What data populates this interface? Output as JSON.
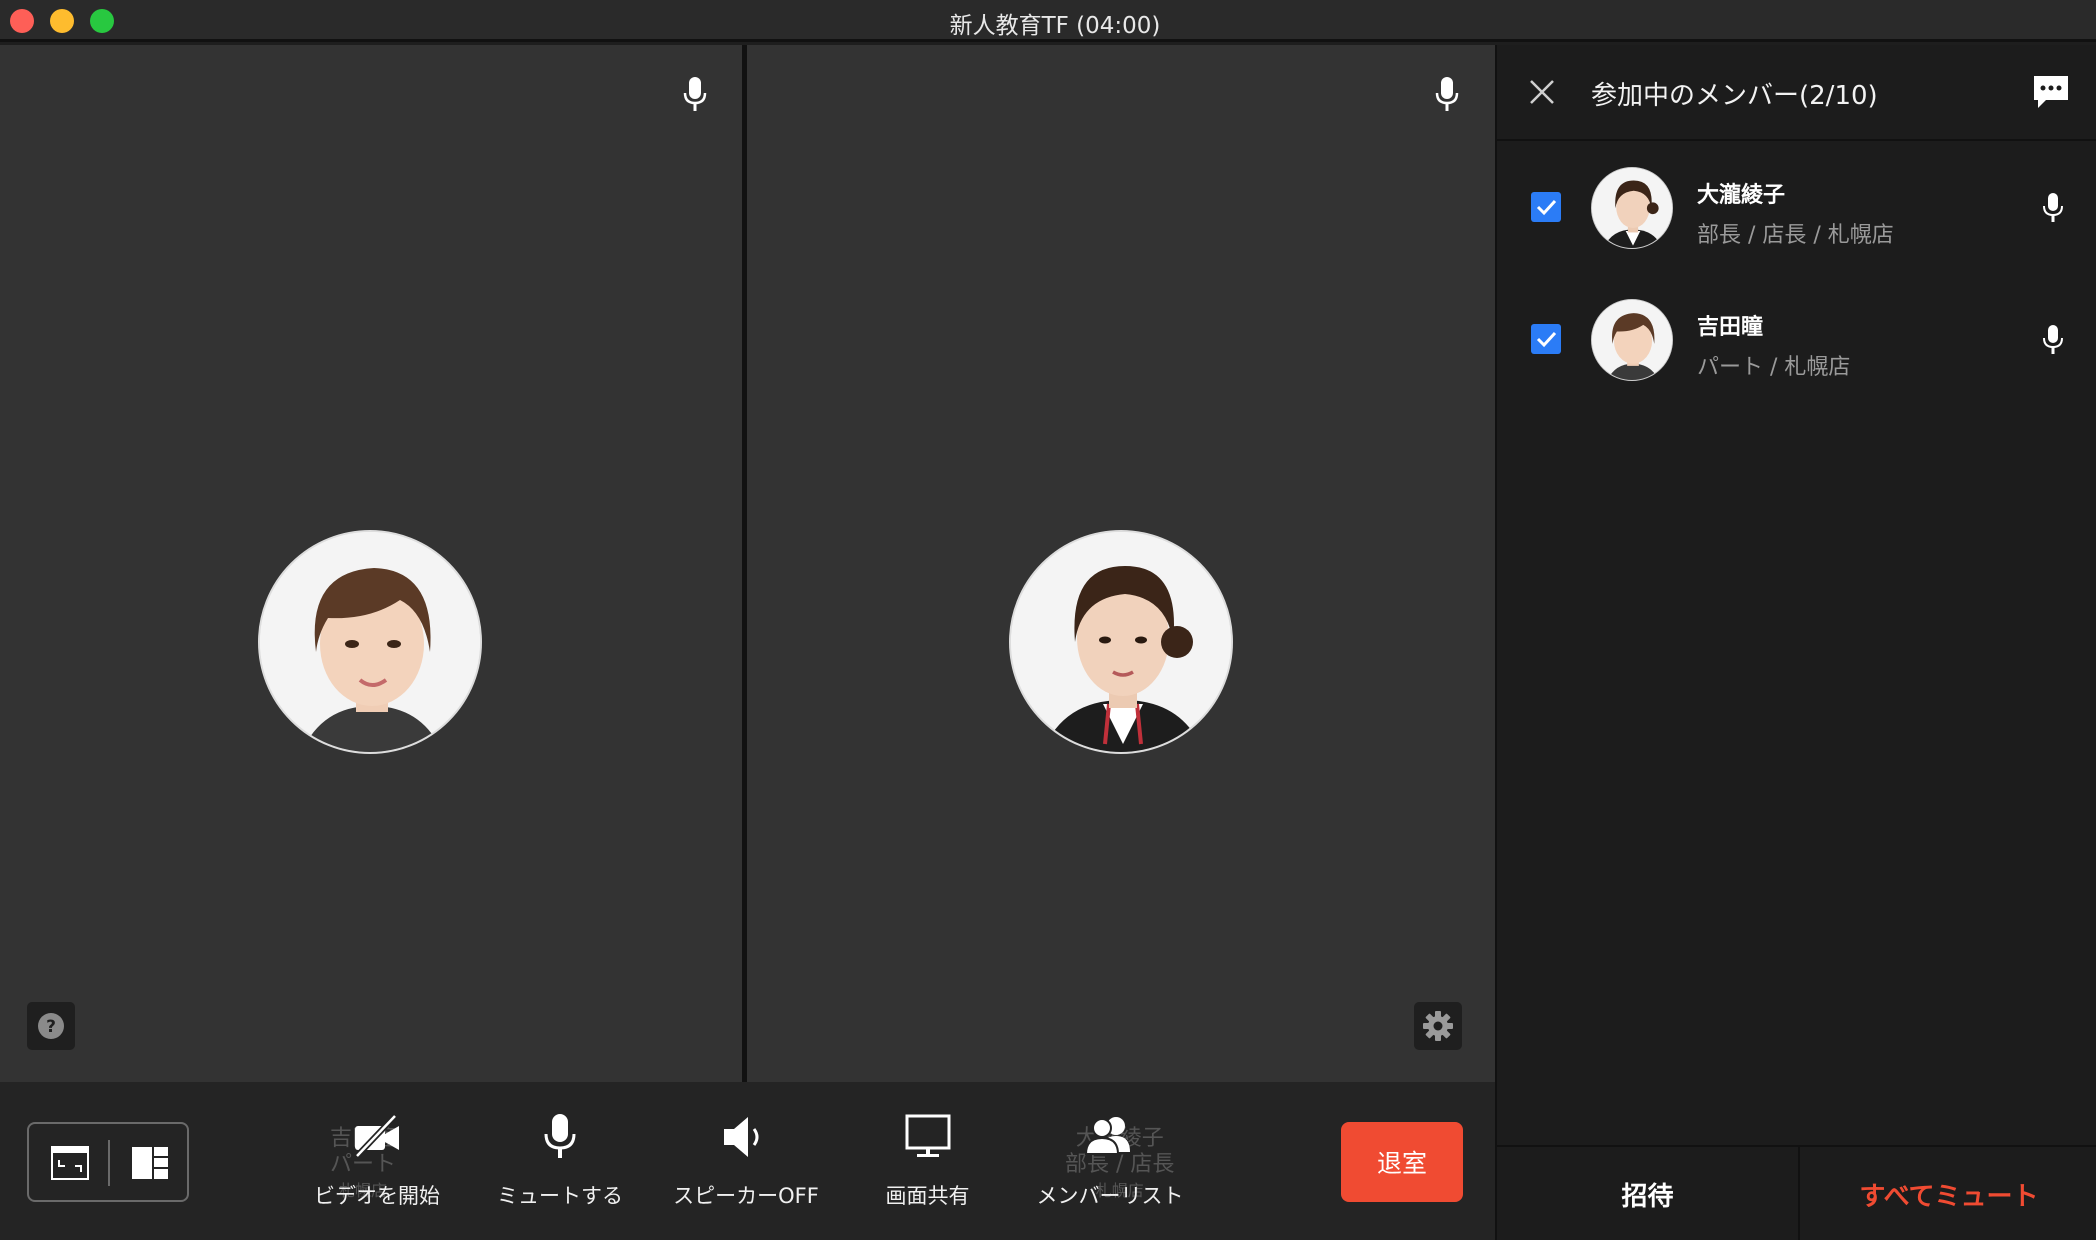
{
  "window": {
    "title": "新人教育TF (04:00)"
  },
  "video": {
    "tiles": [
      {
        "person": "吉田瞳",
        "avatar": "person-avatar-short-hair"
      },
      {
        "person": "大瀧綾子",
        "avatar": "person-avatar-updo"
      }
    ],
    "ghost_left": {
      "line1": "吉田瞳",
      "line2": "パート",
      "line3": "札幌店"
    },
    "ghost_right": {
      "line1": "大瀧綾子",
      "line2": "部長 / 店長",
      "line3": "札幌店"
    }
  },
  "controls": {
    "video_label": "ビデオを開始",
    "mute_label": "ミュートする",
    "speaker_label": "スピーカーOFF",
    "share_label": "画面共有",
    "members_label": "メンバーリスト",
    "leave_label": "退室"
  },
  "sidebar": {
    "title": "参加中のメンバー(2/10)",
    "members": [
      {
        "name": "大瀧綾子",
        "role": "部長 / 店長 / 札幌店",
        "checked": true
      },
      {
        "name": "吉田瞳",
        "role": "パート / 札幌店",
        "checked": true
      }
    ],
    "invite_label": "招待",
    "mute_all_label": "すべてミュート"
  },
  "colors": {
    "accent_blue": "#2b7cf6",
    "leave_red": "#f04b32",
    "background": "#1e1e1e"
  }
}
